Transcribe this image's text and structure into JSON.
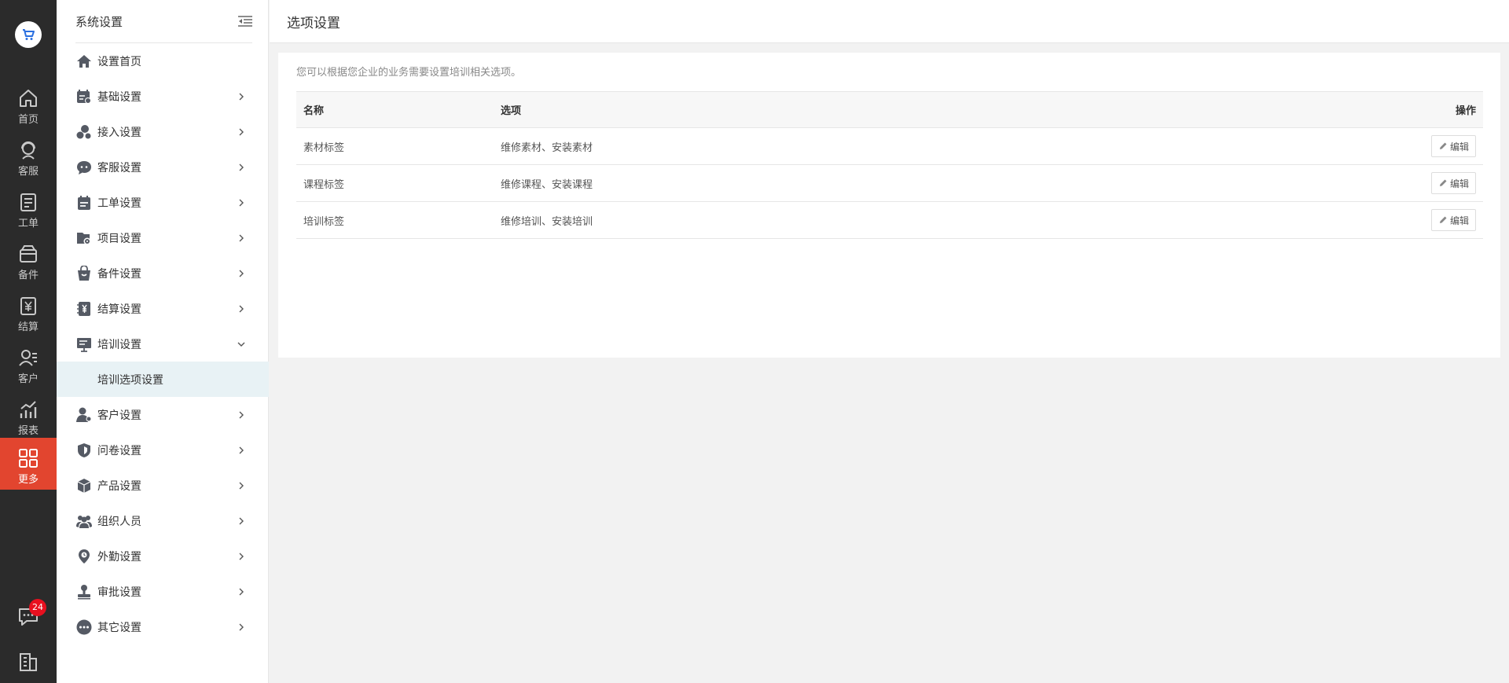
{
  "rail": {
    "items": [
      {
        "label": "首页",
        "icon": "home-icon"
      },
      {
        "label": "客服",
        "icon": "headset-icon"
      },
      {
        "label": "工单",
        "icon": "clipboard-icon"
      },
      {
        "label": "备件",
        "icon": "box-icon"
      },
      {
        "label": "结算",
        "icon": "yen-receipt-icon"
      },
      {
        "label": "客户",
        "icon": "contacts-icon"
      },
      {
        "label": "报表",
        "icon": "chart-icon"
      },
      {
        "label": "更多",
        "icon": "grid-icon",
        "active": true
      }
    ],
    "chat_badge": "24"
  },
  "submenu": {
    "title": "系统设置",
    "items": [
      {
        "label": "设置首页"
      },
      {
        "label": "基础设置"
      },
      {
        "label": "接入设置"
      },
      {
        "label": "客服设置"
      },
      {
        "label": "工单设置"
      },
      {
        "label": "项目设置"
      },
      {
        "label": "备件设置"
      },
      {
        "label": "结算设置"
      },
      {
        "label": "培训设置"
      },
      {
        "label": "培训选项设置"
      },
      {
        "label": "客户设置"
      },
      {
        "label": "问卷设置"
      },
      {
        "label": "产品设置"
      },
      {
        "label": "组织人员"
      },
      {
        "label": "外勤设置"
      },
      {
        "label": "审批设置"
      },
      {
        "label": "其它设置"
      }
    ]
  },
  "page": {
    "title": "选项设置",
    "description": "您可以根据您企业的业务需要设置培训相关选项。"
  },
  "table": {
    "headers": [
      "名称",
      "选项",
      "操作"
    ],
    "rows": [
      {
        "name": "素材标签",
        "options": "维修素材、安装素材",
        "action": "编辑"
      },
      {
        "name": "课程标签",
        "options": "维修课程、安装课程",
        "action": "编辑"
      },
      {
        "name": "培训标签",
        "options": "维修培训、安装培训",
        "action": "编辑"
      }
    ]
  },
  "colors": {
    "rail_bg": "#2b2b2b",
    "rail_active": "#e2452f",
    "submenu_selected": "#e8f2f5",
    "badge": "#e8101f"
  }
}
